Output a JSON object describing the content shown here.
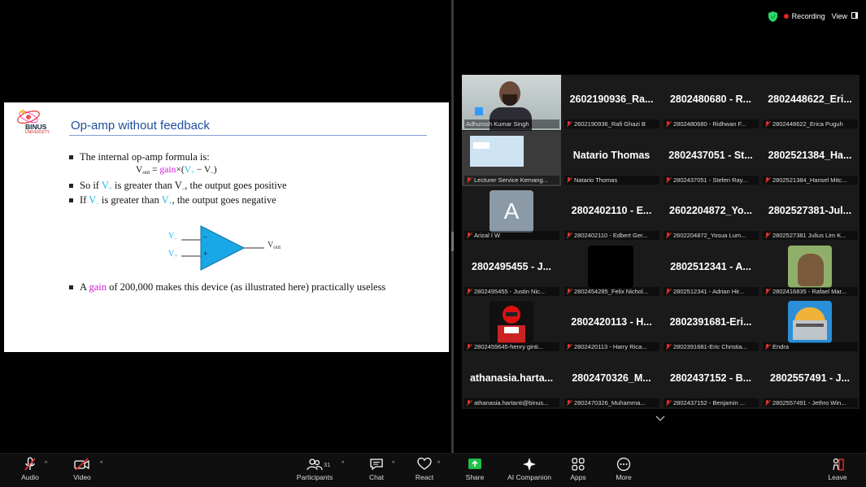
{
  "slide": {
    "logo_text": "BINUS",
    "logo_sub": "UNIVERSITY",
    "title": "Op-amp without feedback",
    "bullet1": "The internal op-amp formula is:",
    "formula": {
      "vout": "V",
      "vout_sub": "out",
      "eq": " = ",
      "gain": "gain",
      "times": "×(",
      "vp": "V",
      "vp_sub": "+",
      "minus": " − ",
      "vm": "V",
      "vm_sub": "–",
      "close": ")"
    },
    "bullet2": {
      "a": "So if ",
      "v1": "V",
      "v1_sub": "+",
      "b": " is greater than ",
      "v2": "V",
      "v2_sub": "–",
      "c": ", the output goes positive"
    },
    "bullet3": {
      "a": "If ",
      "v1": "V",
      "v1_sub": "–",
      "b": " is greater than ",
      "v2": "V",
      "v2_sub": "+",
      "c": ", the output goes negative"
    },
    "diagram": {
      "vminus": "V",
      "vminus_sub": "–",
      "vplus": "V",
      "vplus_sub": "+",
      "minus_sign": "–",
      "plus_sign": "+",
      "vout": "V",
      "vout_sub": "out"
    },
    "bullet4": {
      "a": "A ",
      "gain": "gain",
      "b": " of 200,000 makes this device (as illustrated here) practically useless"
    }
  },
  "topbar": {
    "recording": "Recording",
    "view": "View"
  },
  "participants": [
    {
      "big": "",
      "label": "Adhurosh Kumar Singh",
      "type": "video-person",
      "muted": false
    },
    {
      "big": "2602190936_Ra...",
      "label": "2602190936_Rafi Ghazi B",
      "type": "name"
    },
    {
      "big": "2802480680 - R...",
      "label": "2802480680 - Ridhwan F...",
      "type": "name"
    },
    {
      "big": "2802448622_Eri...",
      "label": "2802448622_Erica Puguh",
      "type": "name"
    },
    {
      "big": "",
      "label": "Lecturer Service Kemang...",
      "type": "video-screen"
    },
    {
      "big": "Natario Thomas",
      "label": "Natario Thomas",
      "type": "name"
    },
    {
      "big": "2802437051 - St...",
      "label": "2802437051 - Stefen Ray...",
      "type": "name"
    },
    {
      "big": "2802521384_Ha...",
      "label": "2802521384_Hansel Mitc...",
      "type": "name"
    },
    {
      "big": "A",
      "label": "Arizal I W",
      "type": "avatar"
    },
    {
      "big": "2802402110 - E...",
      "label": "2802402110 - Edbert Ger...",
      "type": "name"
    },
    {
      "big": "2602204872_Yo...",
      "label": "2602204872_Yosua Lum...",
      "type": "name"
    },
    {
      "big": "2802527381-Jul...",
      "label": "2802527381 Julius Lim K...",
      "type": "name"
    },
    {
      "big": "2802495455 - J...",
      "label": "2802495455 - Justin Nic...",
      "type": "name"
    },
    {
      "big": "",
      "label": "2802454285_Felix Nichol...",
      "type": "video-black"
    },
    {
      "big": "2802512341 - A...",
      "label": "2802512341 - Adrian Hir...",
      "type": "name"
    },
    {
      "big": "",
      "label": "2802416835 - Rafael Mar...",
      "type": "video-capybara"
    },
    {
      "big": "",
      "label": "2802459645-henry ginti...",
      "type": "video-ranger"
    },
    {
      "big": "2802420113 - H...",
      "label": "2802420113 - Harry Rica...",
      "type": "name"
    },
    {
      "big": "2802391681-Eri...",
      "label": "2802391681-Eric Christia...",
      "type": "name"
    },
    {
      "big": "",
      "label": "Endra",
      "type": "video-building"
    },
    {
      "big": "athanasia.harta...",
      "label": "athanasia.hartanti@binus...",
      "type": "name"
    },
    {
      "big": "2802470326_M...",
      "label": "2802470326_Muhamma...",
      "type": "name"
    },
    {
      "big": "2802437152 - B...",
      "label": "2802437152 - Benjamin ...",
      "type": "name"
    },
    {
      "big": "2802557491 - J...",
      "label": "2802557491 - Jethro Win...",
      "type": "name"
    }
  ],
  "toolbar": {
    "audio": "Audio",
    "video": "Video",
    "participants": "Participants",
    "participants_count": "31",
    "chat": "Chat",
    "react": "React",
    "share": "Share",
    "ai": "AI Companion",
    "apps": "Apps",
    "more": "More",
    "leave": "Leave"
  },
  "colors": {
    "accent_green": "#2fd76d",
    "share_green": "#1fbf4a",
    "muted_red": "#e03030",
    "slide_title": "#1f4e9c",
    "opamp_fill": "#1aa7e8"
  }
}
